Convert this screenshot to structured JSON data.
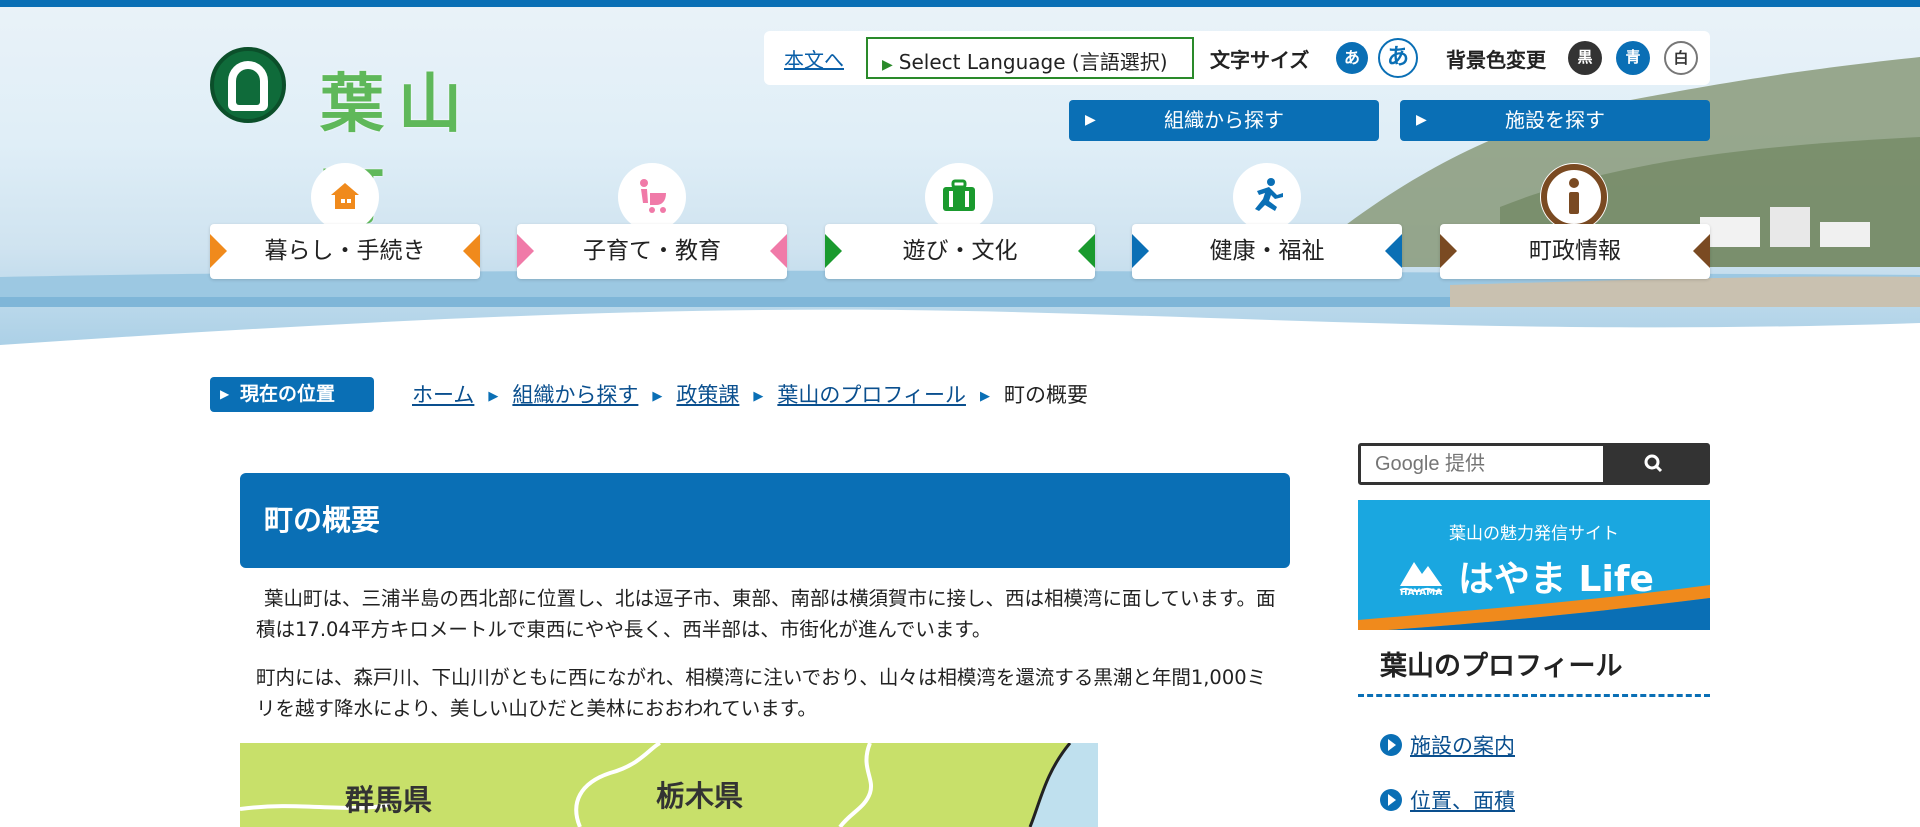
{
  "header": {
    "logo_text": "葉山町",
    "skip_link": "本文へ",
    "language_button": "Select Language (言語選択)",
    "font_size_label": "文字サイズ",
    "font_size_small": "あ",
    "font_size_large": "あ",
    "bg_color_label": "背景色変更",
    "bg_black": "黒",
    "bg_blue": "青",
    "bg_white": "白",
    "find_by_org": "組織から探す",
    "find_by_facility": "施設を探す"
  },
  "nav": {
    "items": [
      {
        "label": "暮らし・手続き",
        "icon": "house-icon",
        "color": "#f08a1c"
      },
      {
        "label": "子育て・教育",
        "icon": "stroller-icon",
        "color": "#f07aa8"
      },
      {
        "label": "遊び・文化",
        "icon": "bag-icon",
        "color": "#1a9a2e"
      },
      {
        "label": "健康・福祉",
        "icon": "runner-icon",
        "color": "#0a6fb5"
      },
      {
        "label": "町政情報",
        "icon": "info-icon",
        "color": "#7a4a22"
      }
    ]
  },
  "breadcrumb": {
    "label": "現在の位置",
    "items": [
      "ホーム",
      "組織から探す",
      "政策課",
      "葉山のプロフィール"
    ],
    "current": "町の概要"
  },
  "main": {
    "title": "町の概要",
    "paragraph1": "葉山町は、三浦半島の西北部に位置し、北は逗子市、東部、南部は横須賀市に接し、西は相模湾に面しています。面積は17.04平方キロメートルで東西にやや長く、西半部は、市街化が進んでいます。",
    "paragraph2": "町内には、森戸川、下山川がともに西にながれ、相模湾に注いでおり、山々は相模湾を還流する黒潮と年間1,000ミリを越す降水により、美しい山ひだと美林におおわれています。",
    "map_labels": [
      "群馬県",
      "栃木県"
    ]
  },
  "sidebar": {
    "search_placeholder": "Google 提供",
    "banner_sub": "葉山の魅力発信サイト",
    "banner_title": "はやま Life",
    "banner_mark": "HAYAMA",
    "section_title": "葉山のプロフィール",
    "links": [
      "施設の案内",
      "位置、面積"
    ]
  },
  "colors": {
    "brand_blue": "#0a6fb5",
    "logo_green": "#5fb85a"
  }
}
